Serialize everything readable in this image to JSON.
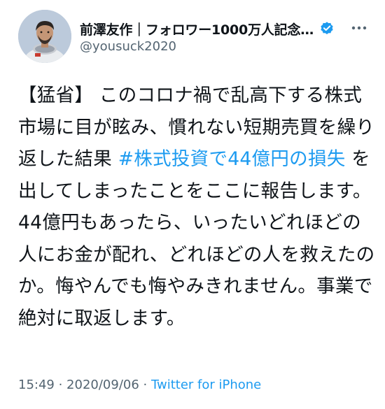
{
  "tweet": {
    "display_name": "前澤友作｜フォロワー1000万人記念…",
    "handle": "@yousuck2020",
    "text": {
      "part1": "【猛省】 このコロナ禍で乱高下する株式市場に目が眩み、慣れない短期売買を繰り返した結果 ",
      "hashtag": "#株式投資で44億円の損失",
      "part2": " を出してしまったことをここに報告します。44億円もあったら、いったいどれほどの人にお金が配れ、どれほどの人を救えたのか。悔やんでも悔やみきれません。事業で絶対に取返します。"
    },
    "time": "15:49",
    "separator1": " · ",
    "date": "2020/09/06",
    "separator2": " · ",
    "source": "Twitter for iPhone"
  },
  "icons": {
    "avatar": "avatar",
    "verified": "verified-badge-icon",
    "more": "more-horizontal-icon"
  },
  "colors": {
    "link": "#1d9bf0",
    "secondary_text": "#536471",
    "primary_text": "#0f1419"
  }
}
